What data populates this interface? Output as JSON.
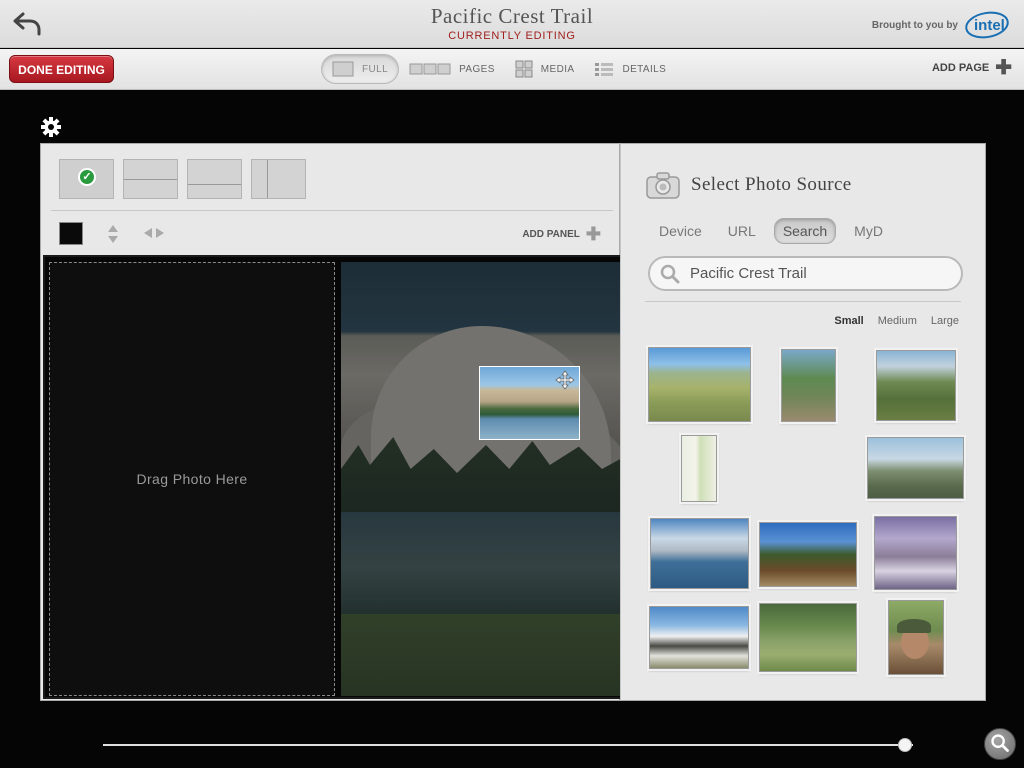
{
  "title_bar": {
    "title": "Pacific Crest Trail",
    "subtitle": "CURRENTLY EDITING",
    "brand_text": "Brought to you by",
    "brand_logo": "intel"
  },
  "toolbar": {
    "done_label": "DONE EDITING",
    "tabs": [
      {
        "label": "FULL",
        "icon": "full-page-icon",
        "active": true
      },
      {
        "label": "PAGES",
        "icon": "pages-icon",
        "active": false
      },
      {
        "label": "MEDIA",
        "icon": "media-grid-icon",
        "active": false
      },
      {
        "label": "DETAILS",
        "icon": "details-list-icon",
        "active": false
      }
    ],
    "add_page_label": "ADD PAGE"
  },
  "editor": {
    "layouts": [
      {
        "icon": "layout-single-icon",
        "selected": true
      },
      {
        "icon": "layout-two-rows-icon",
        "selected": false
      },
      {
        "icon": "layout-two-rows-alt-icon",
        "selected": false
      },
      {
        "icon": "layout-two-columns-icon",
        "selected": false
      }
    ],
    "panel_color": "#0a0a0a",
    "add_panel_label": "ADD PANEL",
    "drop_label": "Drag Photo Here"
  },
  "photo_source": {
    "title": "Select Photo Source",
    "tabs": [
      {
        "label": "Device",
        "active": false
      },
      {
        "label": "URL",
        "active": false
      },
      {
        "label": "Search",
        "active": true
      },
      {
        "label": "MyD",
        "active": false
      }
    ],
    "search_value": "Pacific Crest Trail",
    "sizes": [
      {
        "label": "Small",
        "active": true
      },
      {
        "label": "Medium",
        "active": false
      },
      {
        "label": "Large",
        "active": false
      }
    ]
  },
  "colors": {
    "accent_red": "#b5222a",
    "subtitle_red": "#a0201e",
    "check_green": "#2a9a3e"
  },
  "zoom": {
    "level": 0.99
  }
}
